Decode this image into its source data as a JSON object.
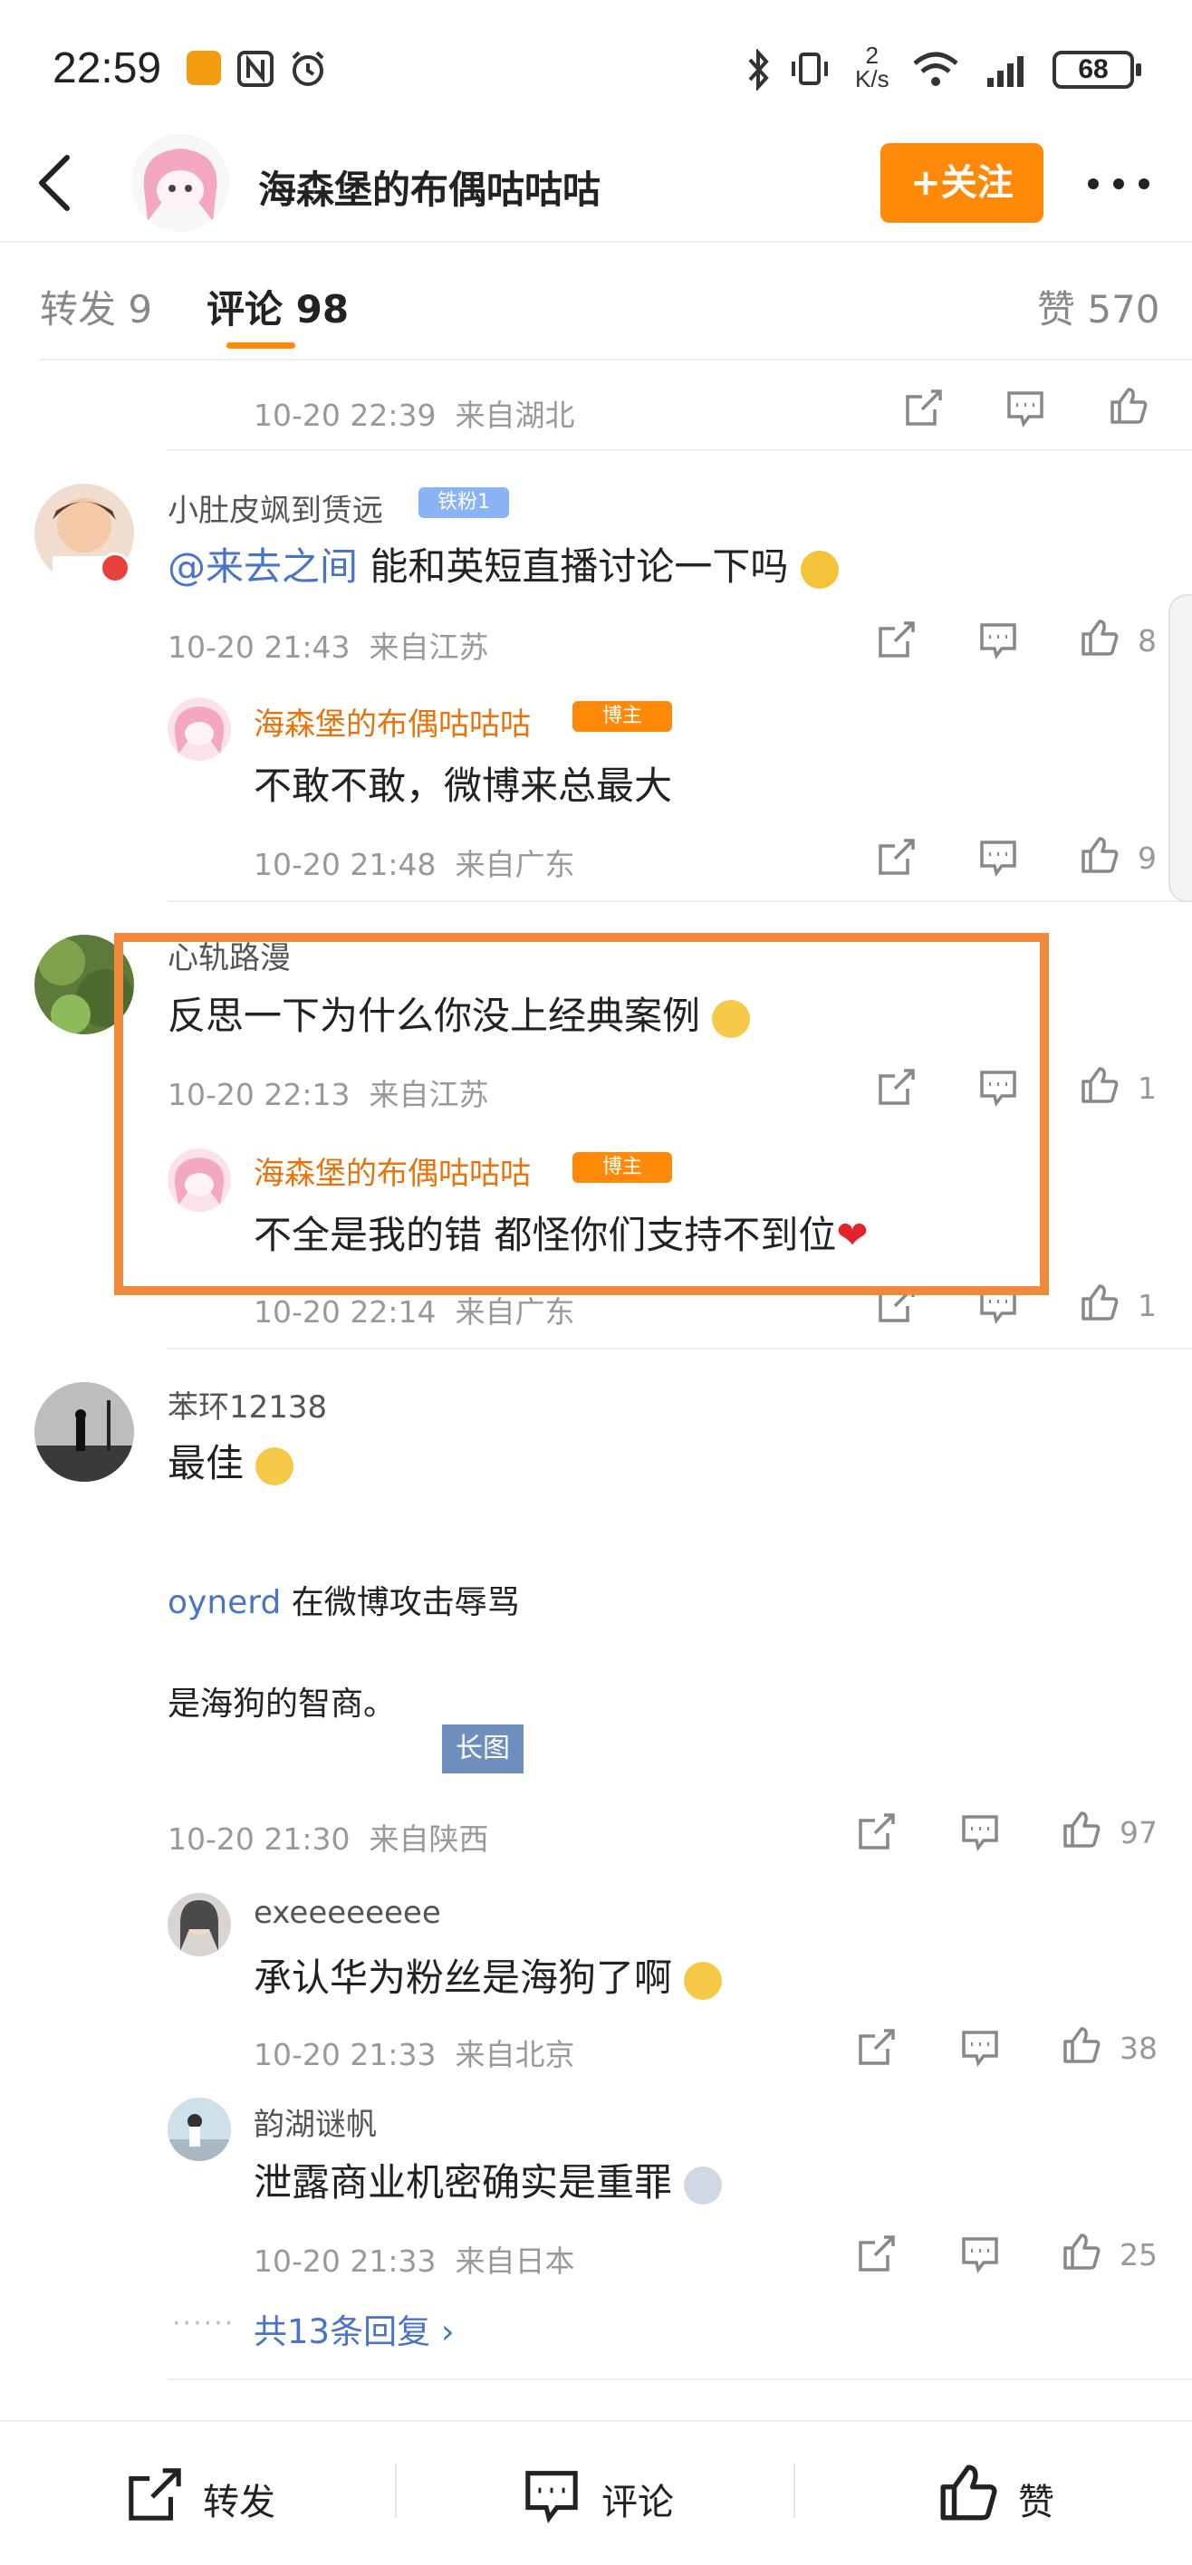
{
  "status_bar": {
    "time": "22:59",
    "net_speed": "2",
    "net_speed_unit": "K/s",
    "battery": "68"
  },
  "header": {
    "title": "海森堡的布偶咕咕咕",
    "follow_label": "+关注"
  },
  "tabs": [
    {
      "label": "转发 9"
    },
    {
      "label": "评论 98"
    },
    {
      "label": "赞 570"
    }
  ],
  "top_meta": {
    "time": "10-20 22:39",
    "location": "来自湖北"
  },
  "comments": [
    {
      "user": "小肚皮飒到赁远",
      "badge": "铁粉1",
      "mention": "@来去之间",
      "text": " 能和英短直播讨论一下吗",
      "time": "10-20 21:43",
      "location": "来自江苏",
      "likes": "8",
      "reply": {
        "user": "海森堡的布偶咕咕咕",
        "badge": "博主",
        "text": "不敢不敢，微博来总最大",
        "time": "10-20 21:48",
        "location": "来自广东",
        "likes": "9"
      }
    },
    {
      "user": "心轨路漫",
      "text": "反思一下为什么你没上经典案例",
      "time": "10-20 22:13",
      "location": "来自江苏",
      "likes": "1",
      "reply": {
        "user": "海森堡的布偶咕咕咕",
        "badge": "博主",
        "text": "不全是我的错 都怪你们支持不到位",
        "time": "10-20 22:14",
        "location": "来自广东",
        "likes": "1"
      }
    },
    {
      "user": "苯环12138",
      "text": "最佳",
      "image_line1_link": "oynerd",
      "image_line1_rest": " 在微博攻击辱骂",
      "image_line2": "是海狗的智商。",
      "long_image_tag": "长图",
      "time": "10-20 21:30",
      "location": "来自陕西",
      "likes": "97",
      "replies": [
        {
          "user": "exeeeeeeee",
          "text": "承认华为粉丝是海狗了啊",
          "time": "10-20 21:33",
          "location": "来自北京",
          "likes": "38"
        },
        {
          "user": "韵湖谜帆",
          "text": "泄露商业机密确实是重罪",
          "time": "10-20 21:33",
          "location": "来自日本",
          "likes": "25"
        }
      ],
      "more_replies": "共13条回复 ›"
    }
  ],
  "bottom_bar": {
    "repost": "转发",
    "comment": "评论",
    "like": "赞"
  },
  "colors": {
    "accent": "#ff8a0a",
    "link": "#4a74c5",
    "author_name": "#e8730c",
    "highlight_box": "#f0893c"
  }
}
